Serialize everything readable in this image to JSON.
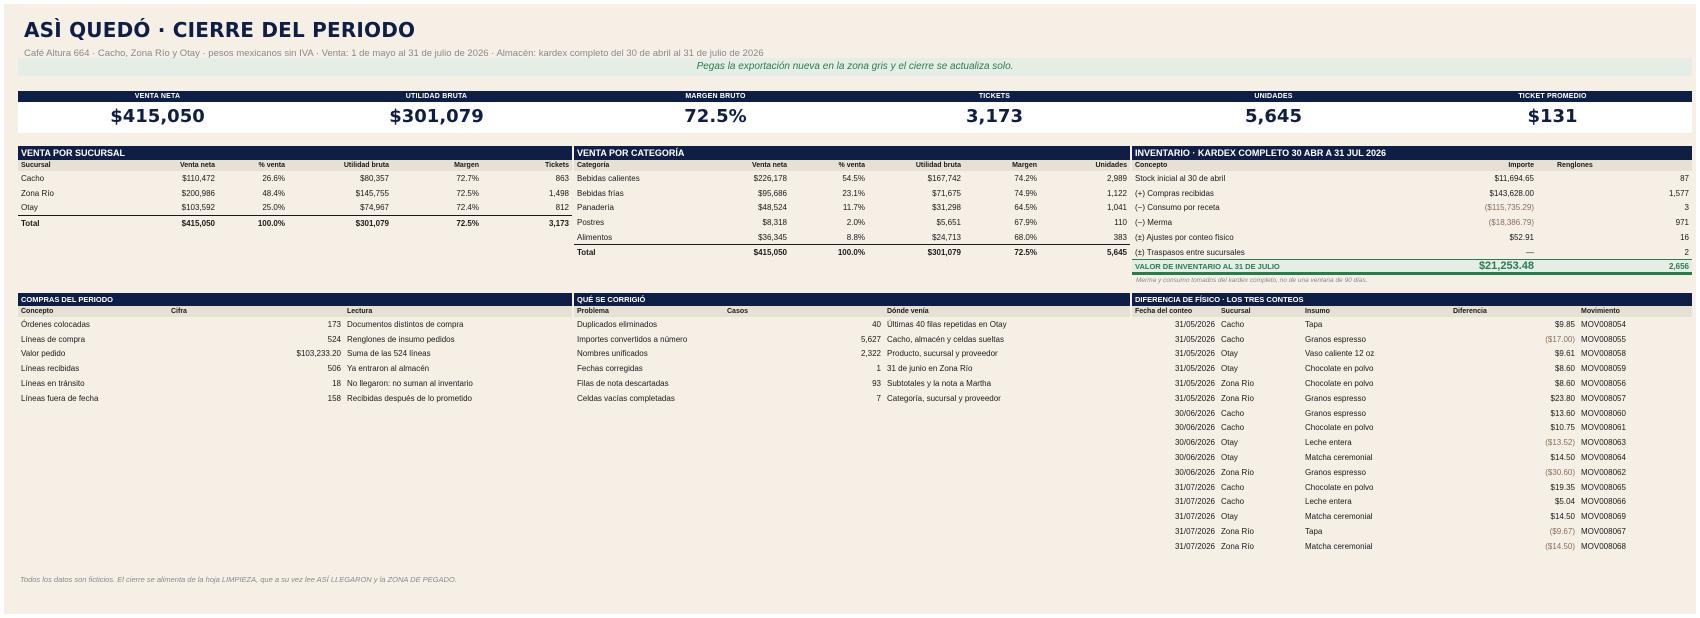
{
  "header": {
    "title": "ASÌ QUEDÓ · CIERRE DEL PERIODO",
    "subtitle": "Café Altura 664 · Cacho, Zona Río y Otay · pesos mexicanos sin IVA · Venta: 1 de mayo al 31 de julio de 2026 · Almacén: kardex completo del 30 de abril al 31 de julio de 2026",
    "banner": "Pegas la exportación nueva en la zona gris y el cierre se actualiza solo."
  },
  "kpis": [
    {
      "label": "VENTA NETA",
      "value": "$415,050"
    },
    {
      "label": "UTILIDAD BRUTA",
      "value": "$301,079"
    },
    {
      "label": "MARGEN BRUTO",
      "value": "72.5%"
    },
    {
      "label": "TICKETS",
      "value": "3,173"
    },
    {
      "label": "UNIDADES",
      "value": "5,645"
    },
    {
      "label": "TICKET PROMEDIO",
      "value": "$131"
    }
  ],
  "sucursal": {
    "title": "VENTA POR SUCURSAL",
    "headers": [
      "Sucursal",
      "Venta neta",
      "% venta",
      "Utilidad bruta",
      "Margen",
      "Tickets"
    ],
    "rows": [
      [
        "Cacho",
        "$110,472",
        "26.6%",
        "$80,357",
        "72.7%",
        "863"
      ],
      [
        "Zona Río",
        "$200,986",
        "48.4%",
        "$145,755",
        "72.5%",
        "1,498"
      ],
      [
        "Otay",
        "$103,592",
        "25.0%",
        "$74,967",
        "72.4%",
        "812"
      ]
    ],
    "total": [
      "Total",
      "$415,050",
      "100.0%",
      "$301,079",
      "72.5%",
      "3,173"
    ]
  },
  "categoria": {
    "title": "VENTA POR CATEGORÍA",
    "headers": [
      "Categoría",
      "Venta neta",
      "% venta",
      "Utilidad bruta",
      "Margen",
      "Unidades"
    ],
    "rows": [
      [
        "Bebidas calientes",
        "$226,178",
        "54.5%",
        "$167,742",
        "74.2%",
        "2,989"
      ],
      [
        "Bebidas frías",
        "$95,686",
        "23.1%",
        "$71,675",
        "74.9%",
        "1,122"
      ],
      [
        "Panadería",
        "$48,524",
        "11.7%",
        "$31,298",
        "64.5%",
        "1,041"
      ],
      [
        "Postres",
        "$8,318",
        "2.0%",
        "$5,651",
        "67.9%",
        "110"
      ],
      [
        "Alimentos",
        "$36,345",
        "8.8%",
        "$24,713",
        "68.0%",
        "383"
      ]
    ],
    "total": [
      "Total",
      "$415,050",
      "100.0%",
      "$301,079",
      "72.5%",
      "5,645"
    ]
  },
  "inventario": {
    "title": "INVENTARIO · KARDEX COMPLETO 30 ABR A 31 JUL 2026",
    "headers": [
      "Concepto",
      "Importe",
      "Renglones"
    ],
    "rows": [
      [
        "Stock inicial al 30 de abril",
        "$11,694.65",
        "87"
      ],
      [
        "(+) Compras recibidas",
        "$143,628.00",
        "1,577"
      ],
      [
        "(−) Consumo por receta",
        "($115,735.29)",
        "3"
      ],
      [
        "(−) Merma",
        "($18,386.79)",
        "971"
      ],
      [
        "(±) Ajustes por conteo físico",
        "$52.91",
        "16"
      ],
      [
        "(±) Traspasos entre sucursales",
        "—",
        "2"
      ]
    ],
    "total": [
      "VALOR DE INVENTARIO AL 31 DE JULIO",
      "$21,253.48",
      "2,656"
    ],
    "note": "Merma y consumo tomados del kardex completo, no de una ventana de 90 días."
  },
  "compras": {
    "title": "COMPRAS DEL PERIODO",
    "headers": [
      "Concepto",
      "Cifra",
      "Lectura"
    ],
    "rows": [
      [
        "Órdenes colocadas",
        "173",
        "Documentos distintos de compra"
      ],
      [
        "Líneas de compra",
        "524",
        "Renglones de insumo pedidos"
      ],
      [
        "Valor pedido",
        "$103,233.20",
        "Suma de las 524 líneas"
      ],
      [
        "Líneas recibidas",
        "506",
        "Ya entraron al almacén"
      ],
      [
        "Líneas en tránsito",
        "18",
        "No llegaron: no suman al inventario"
      ],
      [
        "Líneas fuera de fecha",
        "158",
        "Recibidas después de lo prometido"
      ]
    ]
  },
  "corrigio": {
    "title": "QUÉ SE CORRIGIÓ",
    "headers": [
      "Problema",
      "Casos",
      "Dónde venía"
    ],
    "rows": [
      [
        "Duplicados eliminados",
        "40",
        "Últimas 40 filas repetidas en Otay"
      ],
      [
        "Importes convertidos a número",
        "5,627",
        "Cacho, almacén y celdas sueltas"
      ],
      [
        "Nombres unificados",
        "2,322",
        "Producto, sucursal y proveedor"
      ],
      [
        "Fechas corregidas",
        "1",
        "31 de junio en Zona Río"
      ],
      [
        "Filas de nota descartadas",
        "93",
        "Subtotales y la nota a Martha"
      ],
      [
        "Celdas vacías completadas",
        "7",
        "Categoría, sucursal y proveedor"
      ]
    ]
  },
  "fisico": {
    "title": "DIFERENCIA DE FÍSICO · LOS TRES CONTEOS",
    "headers": [
      "Fecha del conteo",
      "Sucursal",
      "Insumo",
      "Diferencia",
      "Movimiento"
    ],
    "rows": [
      [
        "31/05/2026",
        "Cacho",
        "Tapa",
        "$9.85",
        "MOV008054"
      ],
      [
        "31/05/2026",
        "Cacho",
        "Granos espresso",
        "($17.00)",
        "MOV008055"
      ],
      [
        "31/05/2026",
        "Otay",
        "Vaso caliente 12 oz",
        "$9.61",
        "MOV008058"
      ],
      [
        "31/05/2026",
        "Otay",
        "Chocolate en polvo",
        "$8.60",
        "MOV008059"
      ],
      [
        "31/05/2026",
        "Zona Río",
        "Chocolate en polvo",
        "$8.60",
        "MOV008056"
      ],
      [
        "31/05/2026",
        "Zona Río",
        "Granos espresso",
        "$23.80",
        "MOV008057"
      ],
      [
        "30/06/2026",
        "Cacho",
        "Granos espresso",
        "$13.60",
        "MOV008060"
      ],
      [
        "30/06/2026",
        "Cacho",
        "Chocolate en polvo",
        "$10.75",
        "MOV008061"
      ],
      [
        "30/06/2026",
        "Otay",
        "Leche entera",
        "($13.52)",
        "MOV008063"
      ],
      [
        "30/06/2026",
        "Otay",
        "Matcha ceremonial",
        "$14.50",
        "MOV008064"
      ],
      [
        "30/06/2026",
        "Zona Río",
        "Granos espresso",
        "($30.60)",
        "MOV008062"
      ],
      [
        "31/07/2026",
        "Cacho",
        "Chocolate en polvo",
        "$19.35",
        "MOV008065"
      ],
      [
        "31/07/2026",
        "Cacho",
        "Leche entera",
        "$5.04",
        "MOV008066"
      ],
      [
        "31/07/2026",
        "Otay",
        "Matcha ceremonial",
        "$14.50",
        "MOV008069"
      ],
      [
        "31/07/2026",
        "Zona Río",
        "Tapa",
        "($9.67)",
        "MOV008067"
      ],
      [
        "31/07/2026",
        "Zona Río",
        "Matcha ceremonial",
        "($14.50)",
        "MOV008068"
      ]
    ]
  },
  "footer": "Todos los datos son ficticios. El cierre se alimenta de la hoja LIMPIEZA, que a su vez lee ASÍ LLEGARON y la ZONA DE PEGADO."
}
